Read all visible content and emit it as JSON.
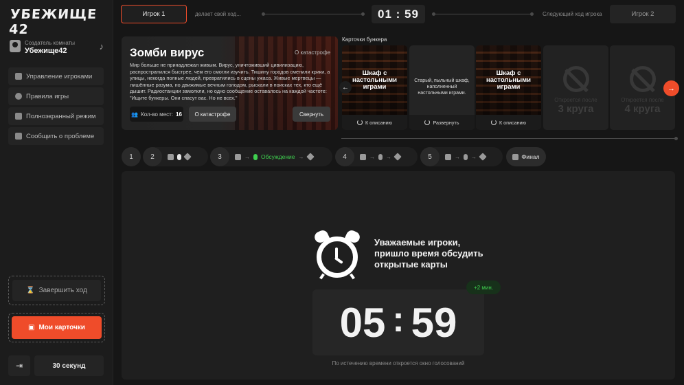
{
  "app": {
    "logo": "УБЕЖИЩЕ 42"
  },
  "creator": {
    "label": "Создатель комнаты",
    "name": "Убежище42"
  },
  "sidebar": {
    "items": [
      {
        "label": "Управление игроками",
        "icon": "edit-icon"
      },
      {
        "label": "Правила игры",
        "icon": "info-icon"
      },
      {
        "label": "Полноэкранный режим",
        "icon": "fullscreen-icon"
      },
      {
        "label": "Сообщить о проблеме",
        "icon": "send-icon"
      }
    ],
    "end_turn": "Завершить ход",
    "my_cards": "Мои карточки",
    "seconds_button": "30 секунд"
  },
  "topbar": {
    "player1": "Игрок 1",
    "player1_status": "делает свой ход...",
    "timer": "01 : 59",
    "next_label": "Следующий ход игрока",
    "player2": "Игрок 2"
  },
  "disaster": {
    "title": "Зомби вирус",
    "tag": "О катастрофе",
    "text": "Мир больше не принадлежал живым. Вирус, уничтоживший цивилизацию, распространился быстрее, чем его смогли изучить. Тишину городов сменили крики, а улицы, некогда полные людей, превратились в сцены ужаса. Живые мертвецы — лишённые разума, но движимые вечным голодом, рыскали в поисках тех, кто ещё дышит. Радиостанции замолкли, но одно сообщение оставалось на каждой частоте: \"Ищите бункеры. Они спасут вас. Но не всех.\"",
    "seats_label": "Кол-во мест:",
    "seats_value": "16",
    "about_button": "О катастрофе",
    "collapse_button": "Свернуть"
  },
  "bunker": {
    "title": "Карточки бункера",
    "cards": [
      {
        "title": "Шкаф с настольными играми",
        "foot": "К описанию"
      },
      {
        "desc": "Старый, пыльный шкаф, наполненный настольными играми.",
        "foot": "Развернуть"
      },
      {
        "title": "Шкаф с настольными играми",
        "foot": "К описанию"
      },
      {
        "ghost_text": "Откроется после",
        "ghost_big": "3 круга"
      },
      {
        "ghost_text": "Откроется после",
        "ghost_big": "4 круга"
      }
    ]
  },
  "steps": {
    "n1": "1",
    "n2": "2",
    "n3": "3",
    "n4": "4",
    "n5": "5",
    "discussion": "Обсуждение",
    "final": "Финал"
  },
  "main": {
    "message": "Уважаемые игроки,\nпришло время обсудить\nоткрытые карты",
    "bonus": "+2 мин.",
    "minutes": "05",
    "seconds": "59",
    "note": "По истечению времени откроется окно голосований"
  },
  "colors": {
    "accent": "#ef4c2a",
    "green": "#3fcf4f",
    "bg": "#161616"
  }
}
